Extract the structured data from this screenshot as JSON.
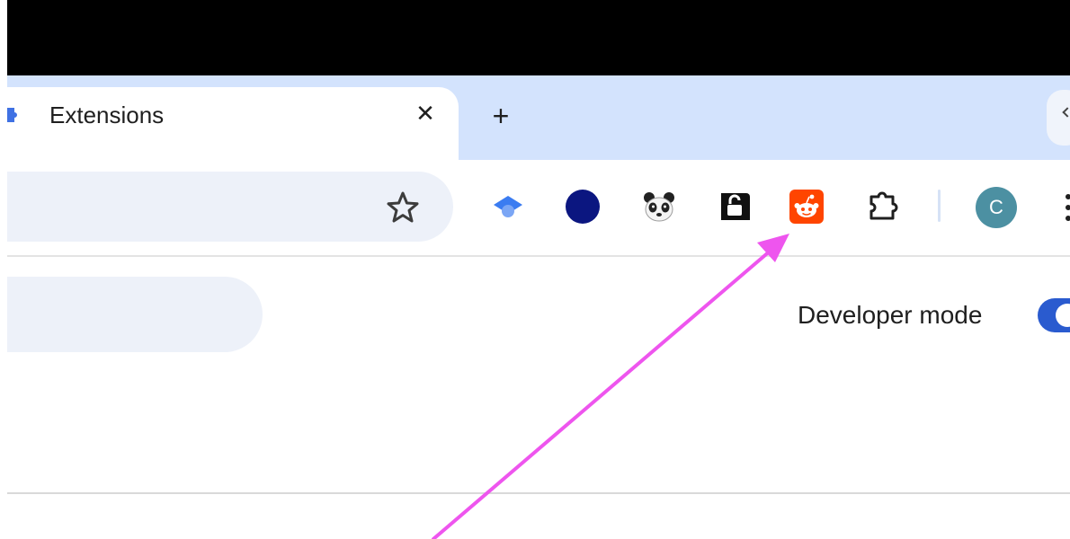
{
  "tab": {
    "title": "Extensions",
    "close_glyph": "✕",
    "new_tab_glyph": "+"
  },
  "toolbar": {
    "icons": [
      "bookmark-star-icon",
      "graduation-cap-extension-icon",
      "navy-circle-extension-icon",
      "panda-extension-icon",
      "lock-extension-icon",
      "reddit-extension-icon",
      "puzzle-extensions-icon"
    ],
    "avatar_initial": "C"
  },
  "page": {
    "developer_mode_label": "Developer mode",
    "developer_mode_on": true
  },
  "colors": {
    "tabstrip": "#d3e3fd",
    "omnibox": "#edf1f9",
    "reddit": "#ff4500",
    "navy": "#0b1680",
    "toggle": "#2a5bcf",
    "annotation_arrow": "#ee55ee",
    "avatar": "#4c90a2"
  }
}
